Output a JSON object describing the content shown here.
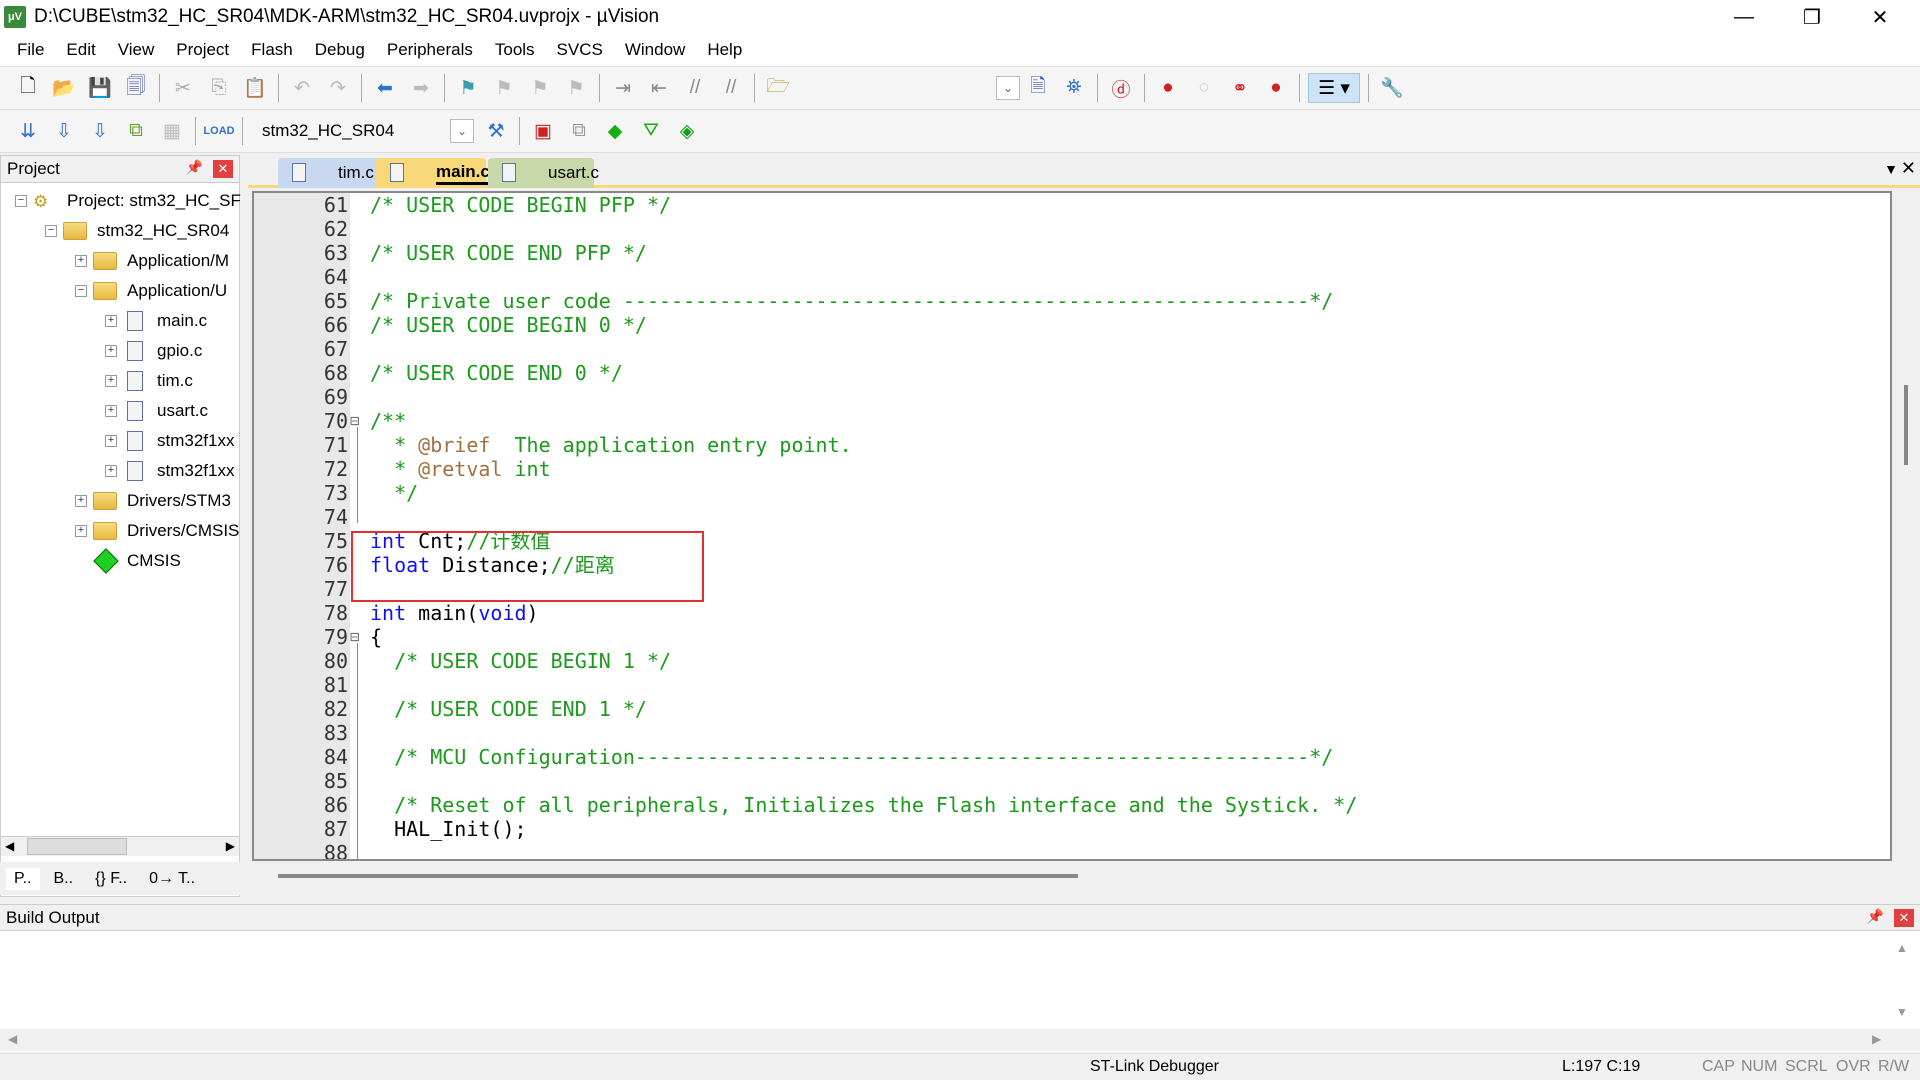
{
  "window": {
    "title": "D:\\CUBE\\stm32_HC_SR04\\MDK-ARM\\stm32_HC_SR04.uvprojx - µVision",
    "icon": "uvision-icon"
  },
  "menu": [
    "File",
    "Edit",
    "View",
    "Project",
    "Flash",
    "Debug",
    "Peripherals",
    "Tools",
    "SVCS",
    "Window",
    "Help"
  ],
  "toolbar": {
    "target": "stm32_HC_SR04"
  },
  "project": {
    "title": "Project",
    "tree": [
      {
        "label": "Project: stm32_HC_SF",
        "indent": 0,
        "exp": "−",
        "icon": "project"
      },
      {
        "label": "stm32_HC_SR04",
        "indent": 1,
        "exp": "−",
        "icon": "target"
      },
      {
        "label": "Application/M",
        "indent": 2,
        "exp": "+",
        "icon": "folder"
      },
      {
        "label": "Application/U",
        "indent": 2,
        "exp": "−",
        "icon": "folder"
      },
      {
        "label": "main.c",
        "indent": 3,
        "exp": "+",
        "icon": "file"
      },
      {
        "label": "gpio.c",
        "indent": 3,
        "exp": "+",
        "icon": "file"
      },
      {
        "label": "tim.c",
        "indent": 3,
        "exp": "+",
        "icon": "file"
      },
      {
        "label": "usart.c",
        "indent": 3,
        "exp": "+",
        "icon": "file"
      },
      {
        "label": "stm32f1xx",
        "indent": 3,
        "exp": "+",
        "icon": "file"
      },
      {
        "label": "stm32f1xx",
        "indent": 3,
        "exp": "+",
        "icon": "file"
      },
      {
        "label": "Drivers/STM3",
        "indent": 2,
        "exp": "+",
        "icon": "folder"
      },
      {
        "label": "Drivers/CMSIS",
        "indent": 2,
        "exp": "+",
        "icon": "folder"
      },
      {
        "label": "CMSIS",
        "indent": 2,
        "exp": "",
        "icon": "gem"
      }
    ],
    "tabs": [
      "P..",
      "B..",
      "{} F..",
      "0→ T.."
    ]
  },
  "editor": {
    "tabs": [
      {
        "label": "tim.c",
        "color": "#c8d8f0"
      },
      {
        "label": "main.c",
        "color": "#f8d878",
        "active": true
      },
      {
        "label": "usart.c",
        "color": "#c8d8a8"
      }
    ],
    "lines": [
      {
        "n": "61",
        "t": [
          [
            "comment",
            "/* USER CODE BEGIN PFP */"
          ]
        ]
      },
      {
        "n": "62",
        "t": []
      },
      {
        "n": "63",
        "t": [
          [
            "comment",
            "/* USER CODE END PFP */"
          ]
        ]
      },
      {
        "n": "64",
        "t": []
      },
      {
        "n": "65",
        "t": [
          [
            "comment",
            "/* Private user code ---------------------------------------------------------*/"
          ]
        ]
      },
      {
        "n": "66",
        "t": [
          [
            "comment",
            "/* USER CODE BEGIN 0 */"
          ]
        ]
      },
      {
        "n": "67",
        "t": []
      },
      {
        "n": "68",
        "t": [
          [
            "comment",
            "/* USER CODE END 0 */"
          ]
        ]
      },
      {
        "n": "69",
        "t": []
      },
      {
        "n": "70",
        "t": [
          [
            "comment",
            "/**"
          ]
        ],
        "fold": "−"
      },
      {
        "n": "71",
        "t": [
          [
            "comment",
            "  * "
          ],
          [
            "tag",
            "@brief"
          ],
          [
            "comment",
            "  The application entry point."
          ]
        ]
      },
      {
        "n": "72",
        "t": [
          [
            "comment",
            "  * "
          ],
          [
            "tag",
            "@retval"
          ],
          [
            "comment",
            " int"
          ]
        ]
      },
      {
        "n": "73",
        "t": [
          [
            "comment",
            "  */"
          ]
        ]
      },
      {
        "n": "74",
        "t": []
      },
      {
        "n": "75",
        "t": [
          [
            "kw",
            "int"
          ],
          [
            "plain",
            " Cnt;"
          ],
          [
            "comment",
            "//计数值"
          ]
        ]
      },
      {
        "n": "76",
        "t": [
          [
            "kw",
            "float"
          ],
          [
            "plain",
            " Distance;"
          ],
          [
            "comment",
            "//距离"
          ]
        ]
      },
      {
        "n": "77",
        "t": []
      },
      {
        "n": "78",
        "t": [
          [
            "kw",
            "int"
          ],
          [
            "plain",
            " main("
          ],
          [
            "kw",
            "void"
          ],
          [
            "plain",
            ")"
          ]
        ]
      },
      {
        "n": "79",
        "t": [
          [
            "plain",
            "{"
          ]
        ],
        "fold": "−"
      },
      {
        "n": "80",
        "t": [
          [
            "comment",
            "  /* USER CODE BEGIN 1 */"
          ]
        ]
      },
      {
        "n": "81",
        "t": []
      },
      {
        "n": "82",
        "t": [
          [
            "comment",
            "  /* USER CODE END 1 */"
          ]
        ]
      },
      {
        "n": "83",
        "t": []
      },
      {
        "n": "84",
        "t": [
          [
            "comment",
            "  /* MCU Configuration--------------------------------------------------------*/"
          ]
        ]
      },
      {
        "n": "85",
        "t": []
      },
      {
        "n": "86",
        "t": [
          [
            "comment",
            "  /* Reset of all peripherals, Initializes the Flash interface and the Systick. */"
          ]
        ]
      },
      {
        "n": "87",
        "t": [
          [
            "plain",
            "  HAL_Init();"
          ]
        ]
      },
      {
        "n": "88",
        "t": []
      }
    ]
  },
  "build": {
    "title": "Build Output"
  },
  "status": {
    "debugger": "ST-Link Debugger",
    "position": "L:197 C:19",
    "cap": "CAP",
    "num": "NUM",
    "scrl": "SCRL",
    "ovr": "OVR",
    "rw": "R/W"
  }
}
